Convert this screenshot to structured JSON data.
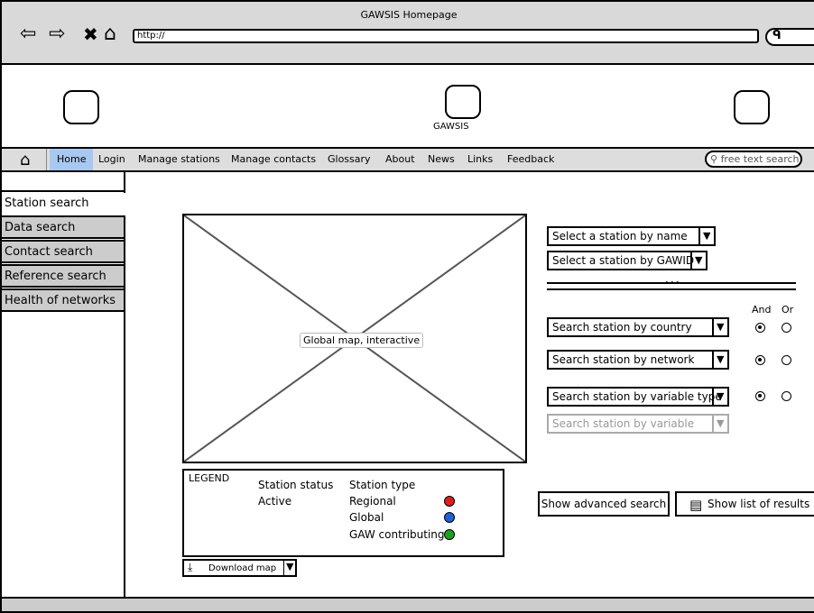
{
  "browser": {
    "title": "GAWSIS Homepage",
    "url": "http://"
  },
  "header": {
    "logo_caption": "GAWSIS"
  },
  "nav": {
    "items": [
      "Home",
      "Login",
      "Manage stations",
      "Manage contacts",
      "Glossary",
      "About",
      "News",
      "Links",
      "Feedback"
    ],
    "active": "Home",
    "search_placeholder": "free text search"
  },
  "sidebar": {
    "items": [
      "Station search",
      "Data search",
      "Contact search",
      "Reference search",
      "Health of networks"
    ],
    "active": "Station search"
  },
  "map": {
    "label": "Global map, interactive"
  },
  "legend": {
    "title": "LEGEND",
    "status_header": "Station status",
    "status_value": "Active",
    "type_header": "Station type",
    "types": [
      {
        "label": "Regional",
        "color": "#d92020"
      },
      {
        "label": "Global",
        "color": "#2060d9"
      },
      {
        "label": "GAW contributing",
        "color": "#20a020"
      }
    ]
  },
  "download": {
    "label": "Download map"
  },
  "form": {
    "select_by_name": "Select a station by name",
    "select_by_gawid": "Select a station by GAWID",
    "col_and": "And",
    "col_or": "Or",
    "by_country": "Search station by country",
    "by_network": "Search station by network",
    "by_variable_type": "Search station by variable type",
    "by_variable": "Search station by variable"
  },
  "actions": {
    "advanced": "Show advanced search",
    "results": "Show list of results"
  }
}
